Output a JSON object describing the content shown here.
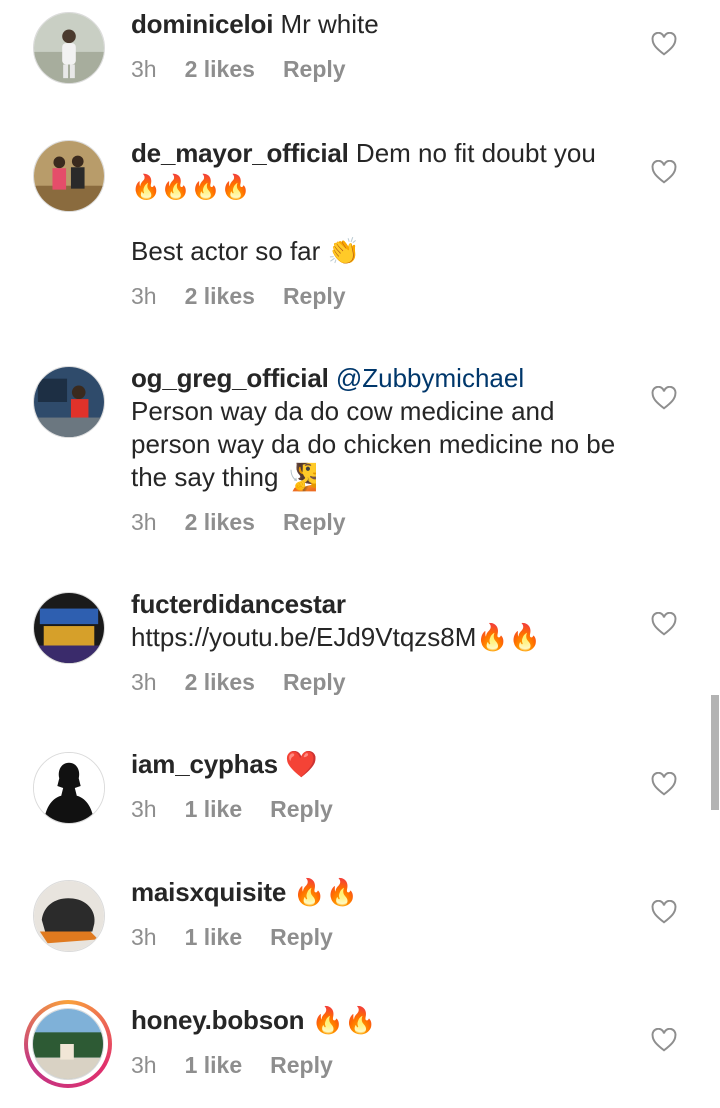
{
  "comments": [
    {
      "username": "dominiceloi",
      "text": " Mr white",
      "time": "3h",
      "likes": "2 likes",
      "reply": "Reply",
      "icon": "avatar-photo"
    },
    {
      "username": "de_mayor_official",
      "text": " Dem no fit doubt you",
      "emojis": "🔥🔥🔥🔥",
      "text2": "Best actor so far 👏",
      "time": "3h",
      "likes": "2 likes",
      "reply": "Reply"
    },
    {
      "username": "og_greg_official",
      "mention": " @Zubbymichael",
      "text": "Person way da do cow medicine and person way da do chicken medicine no be the say thing 🧏",
      "time": "3h",
      "likes": "2 likes",
      "reply": "Reply"
    },
    {
      "username": "fucterdidancestar",
      "text": " https://youtu.be/EJd9Vtqzs8M🔥🔥",
      "time": "3h",
      "likes": "2 likes",
      "reply": "Reply"
    },
    {
      "username": "iam_cyphas",
      "text": " ❤️",
      "time": "3h",
      "likes": "1 like",
      "reply": "Reply"
    },
    {
      "username": "maisxquisite",
      "text": " 🔥🔥",
      "time": "3h",
      "likes": "1 like",
      "reply": "Reply"
    },
    {
      "username": "honey.bobson",
      "text": " 🔥🔥",
      "time": "3h",
      "likes": "1 like",
      "reply": "Reply"
    }
  ],
  "colors": {
    "text": "#262626",
    "meta": "#8e8e8e",
    "mention": "#00376b",
    "story_ring": "#e1306c"
  }
}
